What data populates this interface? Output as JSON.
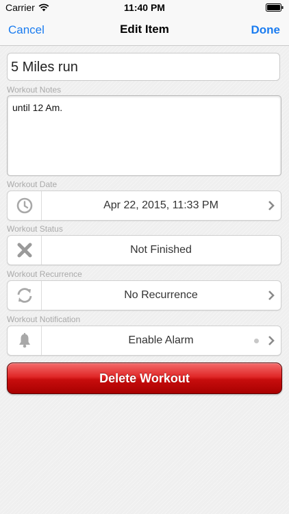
{
  "status_bar": {
    "carrier": "Carrier",
    "time": "11:40 PM"
  },
  "nav": {
    "cancel_label": "Cancel",
    "title": "Edit Item",
    "done_label": "Done"
  },
  "item": {
    "name": "5 Miles run"
  },
  "notes": {
    "label": "Workout Notes",
    "value": "until 12 Am."
  },
  "date": {
    "label": "Workout Date",
    "value": "Apr 22, 2015, 11:33 PM",
    "icon": "clock-icon"
  },
  "status": {
    "label": "Workout Status",
    "value": "Not Finished",
    "icon": "x-mark-icon"
  },
  "recurrence": {
    "label": "Workout Recurrence",
    "value": "No Recurrence",
    "icon": "repeat-icon"
  },
  "notification": {
    "label": "Workout Notification",
    "value": "Enable Alarm",
    "icon": "bell-icon"
  },
  "delete": {
    "label": "Delete Workout"
  },
  "colors": {
    "accent": "#1a7cf0",
    "delete_red": "#d01515",
    "label_gray": "#a9a9a9"
  }
}
